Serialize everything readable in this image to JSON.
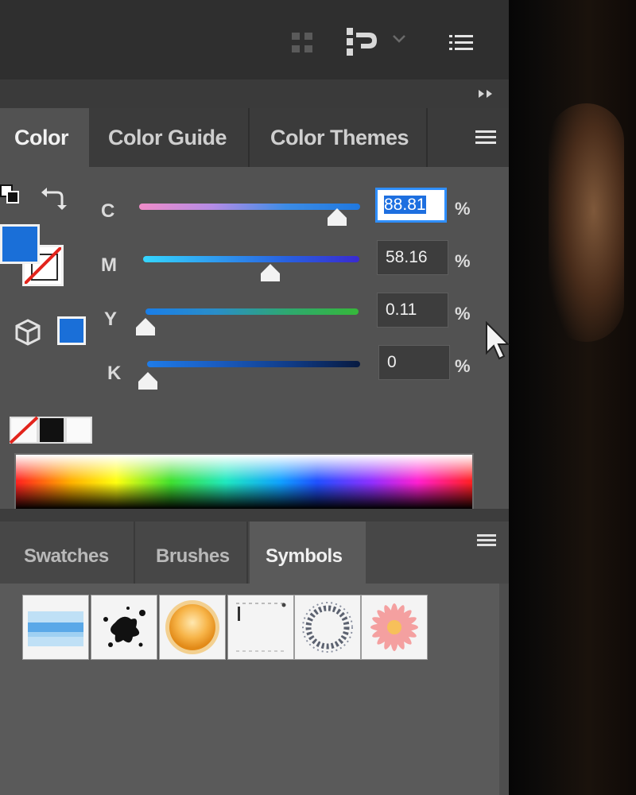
{
  "toolbar": {
    "icons": [
      "grid-icon",
      "gpu-icon",
      "chevron-down-icon",
      "menu-icon"
    ]
  },
  "color_panel": {
    "tabs": [
      {
        "label": "Color",
        "active": true
      },
      {
        "label": "Color Guide",
        "active": false
      },
      {
        "label": "Color Themes",
        "active": false
      }
    ],
    "mode": "CMYK",
    "fill_color": "#1a6fd8",
    "sliders": [
      {
        "channel": "C",
        "value": "88.81",
        "level": 0.8881,
        "unit": "%",
        "focused": true
      },
      {
        "channel": "M",
        "value": "58.16",
        "level": 0.5816,
        "unit": "%",
        "focused": false
      },
      {
        "channel": "Y",
        "value": "0.11",
        "level": 0.0011,
        "unit": "%",
        "focused": false
      },
      {
        "channel": "K",
        "value": "0",
        "level": 0,
        "unit": "%",
        "focused": false
      }
    ]
  },
  "library_panel": {
    "tabs": [
      {
        "label": "Swatches",
        "active": false
      },
      {
        "label": "Brushes",
        "active": false
      },
      {
        "label": "Symbols",
        "active": true
      }
    ],
    "symbols": [
      "blue-banner",
      "ink-splatter",
      "orange-orb",
      "frame",
      "ring-of-dots",
      "pink-flower"
    ]
  }
}
